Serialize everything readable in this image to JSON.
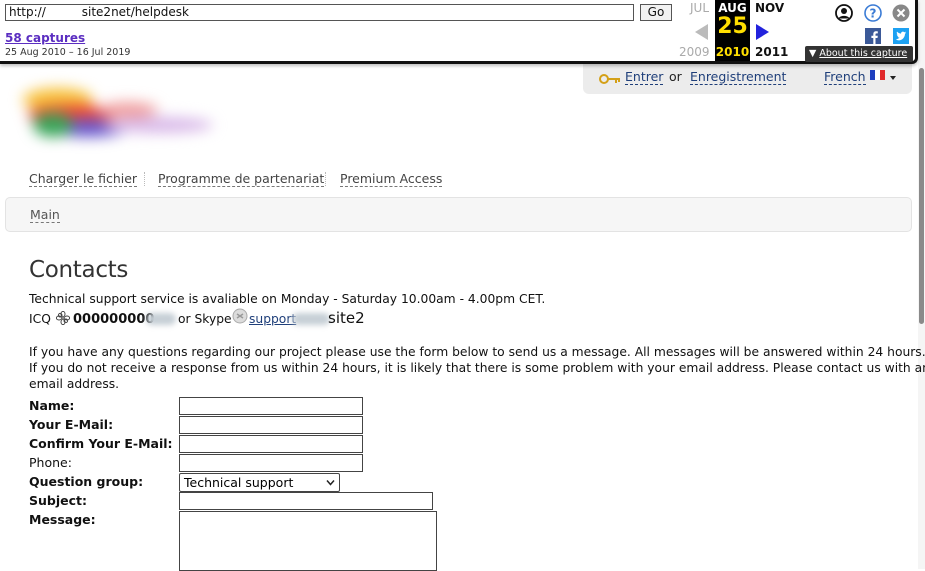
{
  "wayback": {
    "url": "http://   site2net/helpdesk",
    "go_label": "Go",
    "captures_label": "58 captures",
    "date_range": "25 Aug 2010 – 16 Jul 2019",
    "months": {
      "prev": "JUL",
      "current": "AUG",
      "next": "NOV"
    },
    "day": "25",
    "years": {
      "prev": "2009",
      "current": "2010",
      "next": "2011"
    },
    "about_label": "About this capture",
    "colors": {
      "current_bg": "#000000",
      "current_text": "#ffde00",
      "next_arrow": "#2222dd"
    }
  },
  "header": {
    "login_label": "Entrer",
    "or_label": "or",
    "register_label": "Enregistrement",
    "language_label": "French"
  },
  "nav": {
    "upload_label": "Charger le fichier",
    "partner_label": "Programme de partenariat",
    "premium_label": "Premium Access"
  },
  "breadcrumb": {
    "main_label": "Main"
  },
  "content": {
    "title": "Contacts",
    "support_hours": "Technical support service is avaliable on Monday - Saturday 10.00am - 4.00pm CET.",
    "icq_label": "ICQ",
    "icq_number": "000000000",
    "or_skype": "or Skype",
    "skype_link": "support",
    "skype_suffix": "site2",
    "info_1": "If you have any questions regarding our project please use the form below to send us a message. All messages will be answered within 24 hours.",
    "info_2": "If you do not receive a response from us within 24 hours, it is likely that there is some problem with your email address. Please contact us with another",
    "info_3": "email address."
  },
  "form": {
    "name_label": "Name:",
    "email_label": "Your E-Mail:",
    "confirm_email_label": "Confirm Your E-Mail:",
    "phone_label": "Phone:",
    "question_group_label": "Question group:",
    "question_group_value": "Technical support",
    "subject_label": "Subject:",
    "message_label": "Message:"
  }
}
